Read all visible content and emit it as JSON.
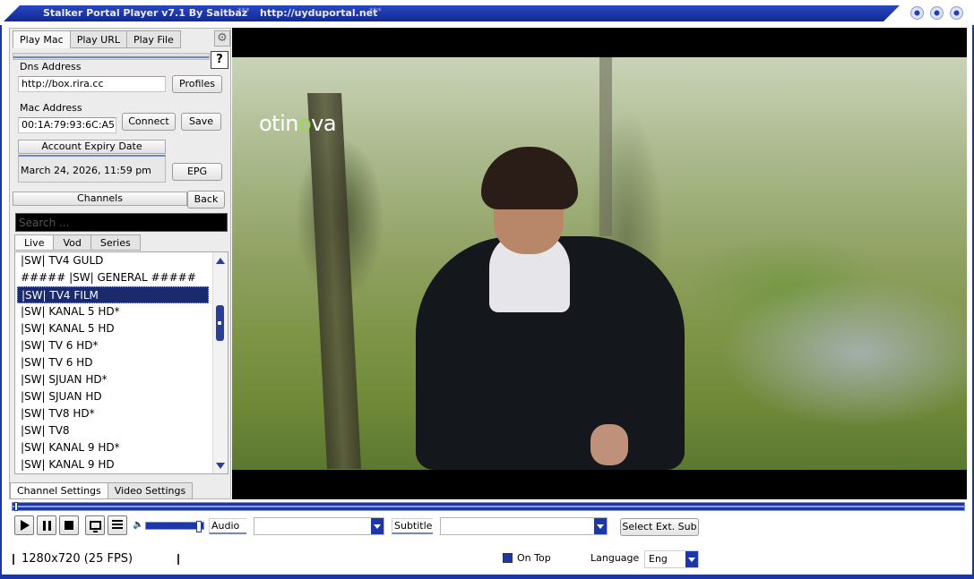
{
  "window": {
    "title": "Stalker Portal Player v7.1 By Saitbaz",
    "url": "http://uyduportal.net",
    "stars": "***"
  },
  "tabs_top": [
    {
      "label": "Play Mac",
      "active": true
    },
    {
      "label": "Play URL",
      "active": false
    },
    {
      "label": "Play File",
      "active": false
    }
  ],
  "help_label": "?",
  "dns": {
    "label": "Dns Address",
    "value": "http://box.rira.cc",
    "profiles_button": "Profiles"
  },
  "mac": {
    "label": "Mac Address",
    "value": "00:1A:79:93:6C:A5",
    "connect_button": "Connect",
    "save_button": "Save"
  },
  "expiry": {
    "label": "Account Expiry Date",
    "value": "March 24, 2026, 11:59 pm",
    "epg_button": "EPG"
  },
  "channels": {
    "label": "Channels",
    "back_button": "Back"
  },
  "search": {
    "placeholder": "Search ..."
  },
  "list_tabs": [
    {
      "label": "Live",
      "active": true
    },
    {
      "label": "Vod",
      "active": false
    },
    {
      "label": "Series",
      "active": false
    }
  ],
  "channel_list": [
    "|SW| TV4 GULD",
    "##### |SW| GENERAL #####",
    "|SW| TV4 FILM",
    "|SW| KANAL 5 HD*",
    "|SW| KANAL 5 HD",
    "|SW| TV 6 HD*",
    "|SW| TV 6 HD",
    "|SW| SJUAN HD*",
    "|SW| SJUAN HD",
    "|SW| TV8 HD*",
    "|SW| TV8",
    "|SW| KANAL 9 HD*",
    "|SW| KANAL 9 HD"
  ],
  "selected_channel": "|SW| TV4 FILM",
  "bottom_tabs": [
    {
      "label": "Channel Settings",
      "active": true
    },
    {
      "label": "Video Settings",
      "active": false
    }
  ],
  "video": {
    "logo_text": "otinova"
  },
  "controls": {
    "audio_label": "Audio",
    "audio_value": "",
    "subtitle_label": "Subtitle",
    "subtitle_value": "",
    "ext_sub_button": "Select Ext. Sub",
    "volume_level": 0.9,
    "seek_position": 0.0
  },
  "status": {
    "resolution": "1280x720  (25 FPS)",
    "on_top_label": "On Top",
    "on_top_checked": true,
    "language_label": "Language",
    "language_value": "Eng"
  },
  "colors": {
    "accent": "#1c38a8",
    "selection": "#1a2a6c"
  }
}
